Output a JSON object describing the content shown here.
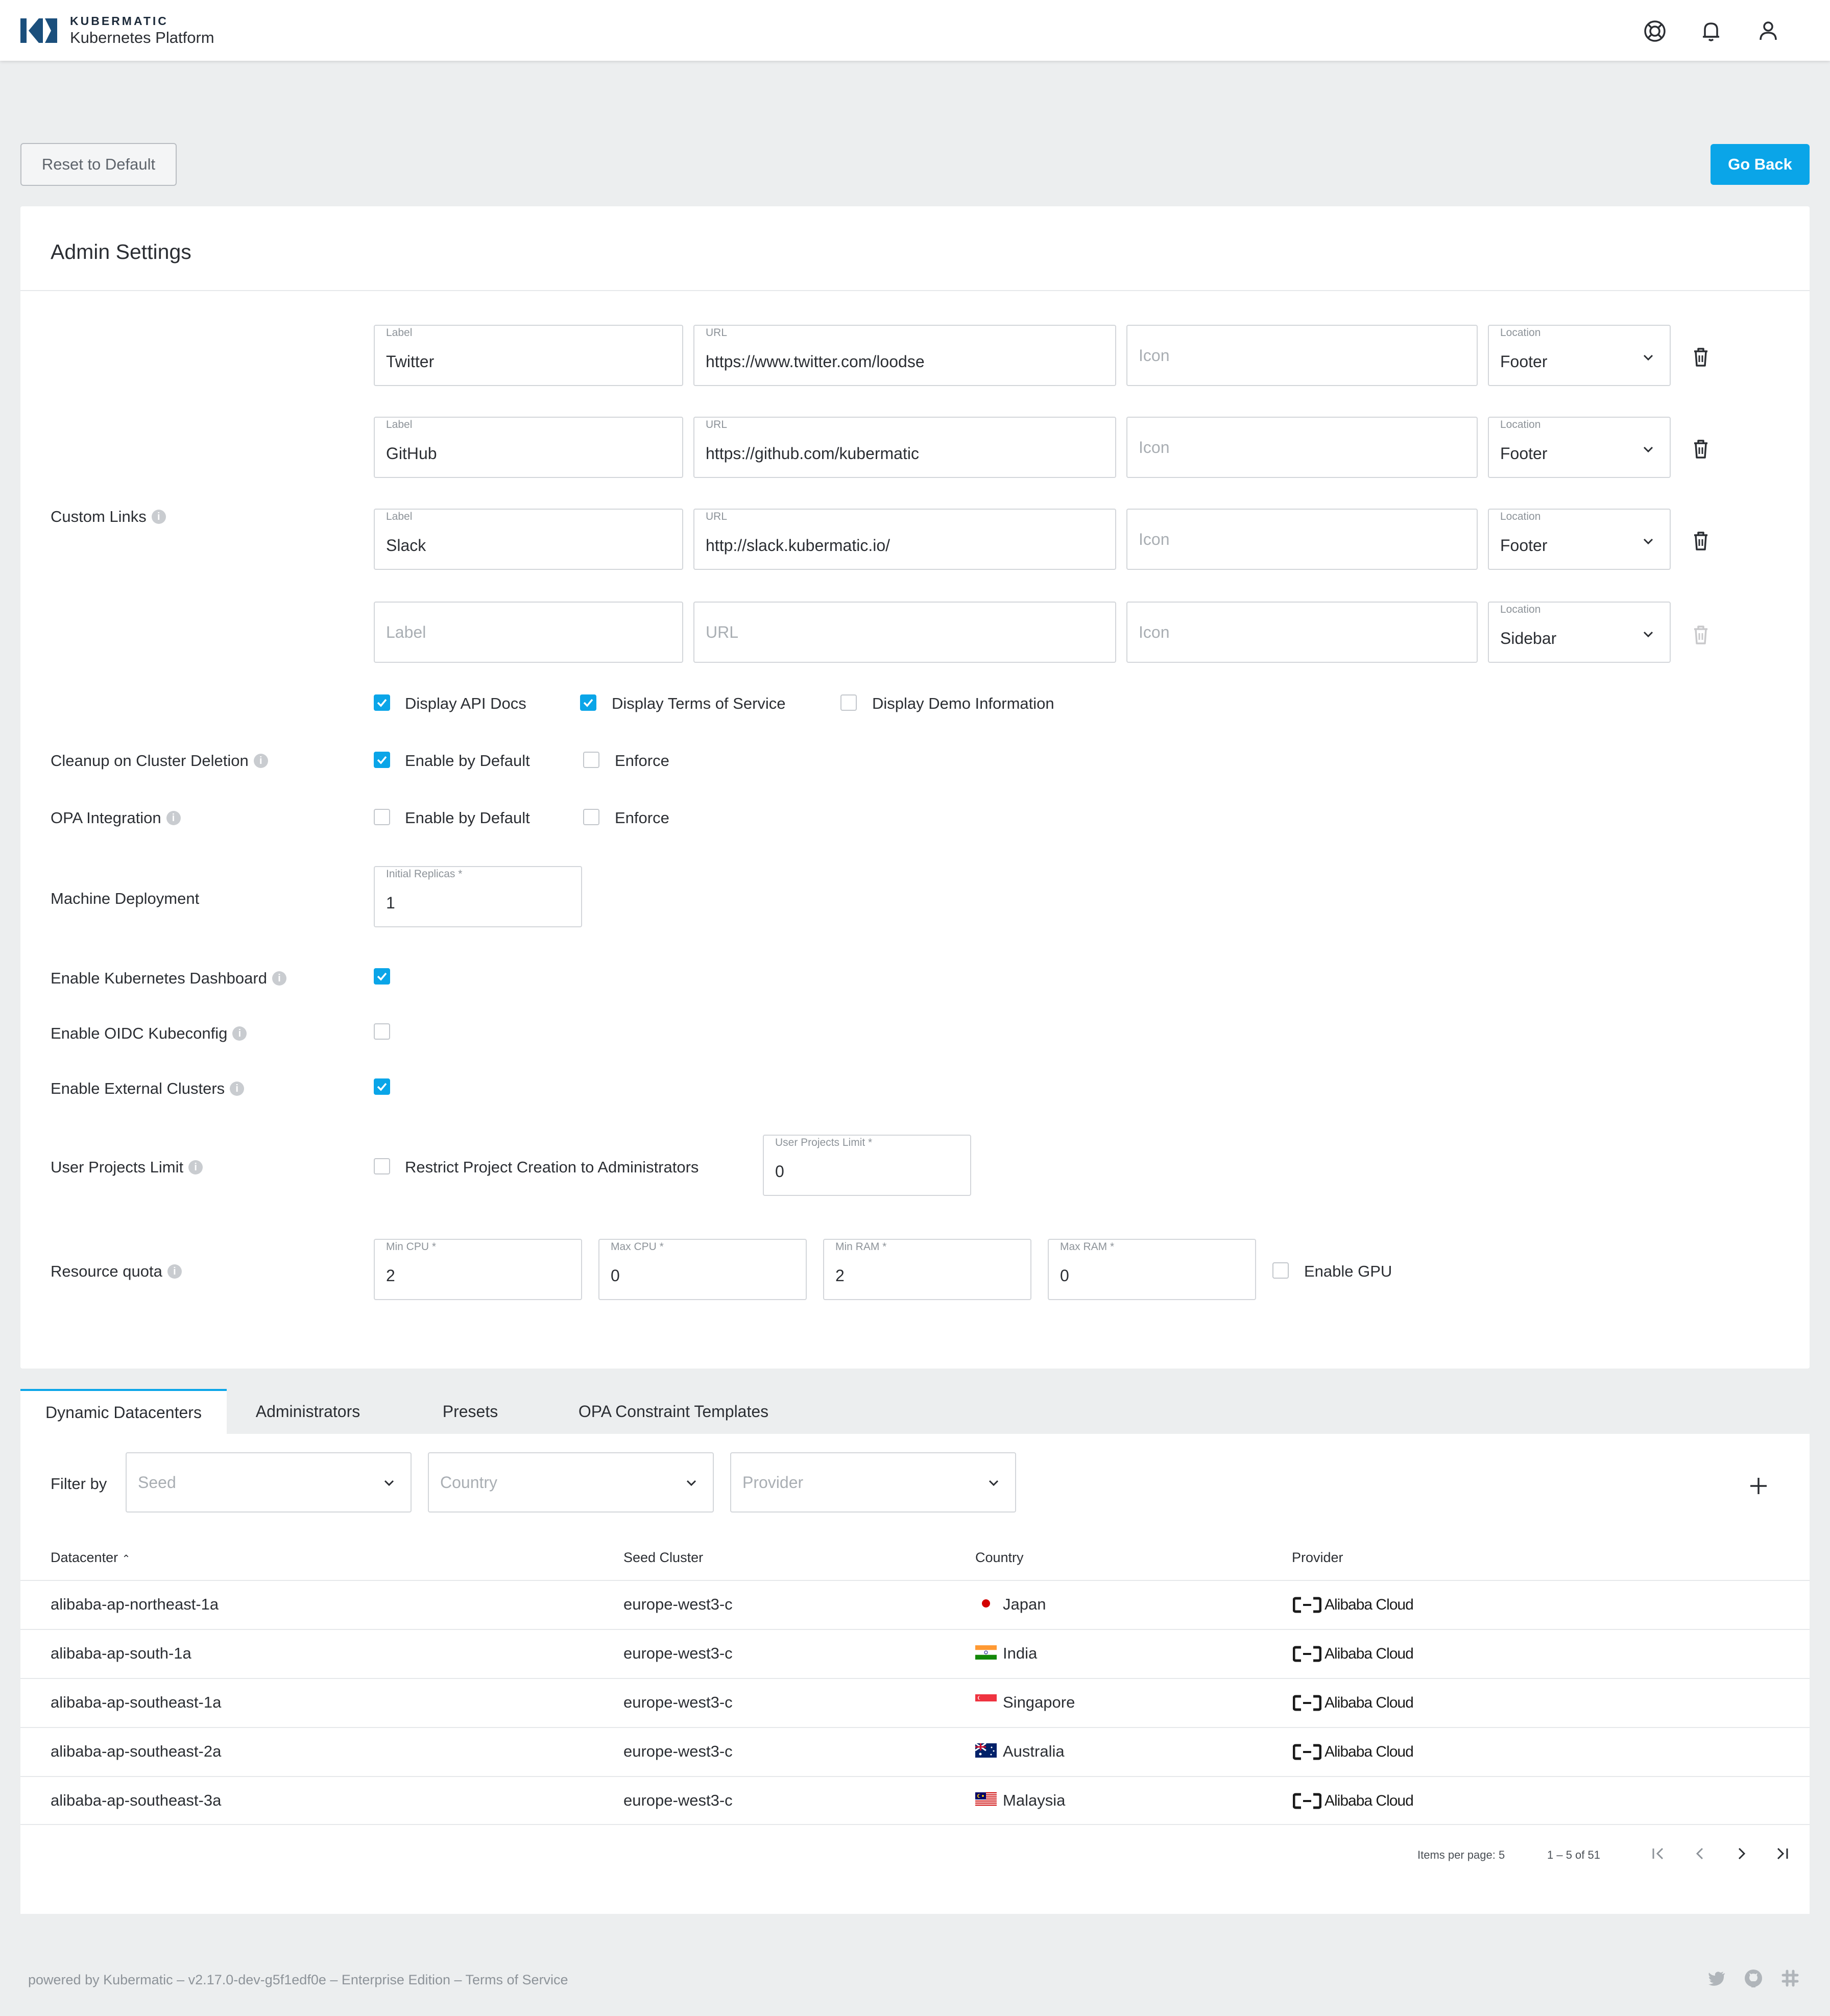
{
  "header": {
    "brand": "KUBERMATIC",
    "subtitle": "Kubernetes Platform",
    "icons": [
      "help-icon",
      "bell-icon",
      "user-icon"
    ]
  },
  "actions": {
    "reset": "Reset to Default",
    "go_back": "Go Back"
  },
  "admin": {
    "title": "Admin Settings",
    "custom_links": {
      "label": "Custom Links",
      "field_labels": {
        "label": "Label",
        "url": "URL",
        "icon": "Icon",
        "location": "Location"
      },
      "rows": [
        {
          "label": "Twitter",
          "url": "https://www.twitter.com/loodse",
          "icon": "",
          "location": "Footer"
        },
        {
          "label": "GitHub",
          "url": "https://github.com/kubermatic",
          "icon": "",
          "location": "Footer"
        },
        {
          "label": "Slack",
          "url": "http://slack.kubermatic.io/",
          "icon": "",
          "location": "Footer"
        },
        {
          "label": "",
          "url": "",
          "icon": "",
          "location": "Sidebar"
        }
      ],
      "display_options": [
        {
          "label": "Display API Docs",
          "checked": true
        },
        {
          "label": "Display Terms of Service",
          "checked": true
        },
        {
          "label": "Display Demo Information",
          "checked": false
        }
      ]
    },
    "cleanup": {
      "label": "Cleanup on Cluster Deletion",
      "enable_by_default": "Enable by Default",
      "enforce": "Enforce"
    },
    "opa": {
      "label": "OPA Integration",
      "enable_by_default": "Enable by Default",
      "enforce": "Enforce"
    },
    "machine_deployment": {
      "label": "Machine Deployment",
      "field_label": "Initial Replicas *",
      "value": "1"
    },
    "k8s_dashboard": {
      "label": "Enable Kubernetes Dashboard",
      "checked": true
    },
    "oidc": {
      "label": "Enable OIDC Kubeconfig",
      "checked": false
    },
    "external_clusters": {
      "label": "Enable External Clusters",
      "checked": true
    },
    "user_projects": {
      "label": "User Projects Limit",
      "restrict": "Restrict Project Creation to Administrators",
      "field_label": "User Projects Limit *",
      "value": "0"
    },
    "resource_quota": {
      "label": "Resource quota",
      "min_cpu_label": "Min CPU *",
      "min_cpu": "2",
      "max_cpu_label": "Max CPU *",
      "max_cpu": "0",
      "min_ram_label": "Min RAM *",
      "min_ram": "2",
      "max_ram_label": "Max RAM *",
      "max_ram": "0",
      "gpu": "Enable GPU"
    }
  },
  "tabs": [
    "Dynamic Datacenters",
    "Administrators",
    "Presets",
    "OPA Constraint Templates"
  ],
  "filters": {
    "label": "Filter by",
    "seed": "Seed",
    "country": "Country",
    "provider": "Provider"
  },
  "table": {
    "columns": [
      "Datacenter",
      "Seed Cluster",
      "Country",
      "Provider"
    ],
    "rows": [
      {
        "datacenter": "alibaba-ap-northeast-1a",
        "seed": "europe-west3-c",
        "country": "Japan",
        "provider": "Alibaba Cloud"
      },
      {
        "datacenter": "alibaba-ap-south-1a",
        "seed": "europe-west3-c",
        "country": "India",
        "provider": "Alibaba Cloud"
      },
      {
        "datacenter": "alibaba-ap-southeast-1a",
        "seed": "europe-west3-c",
        "country": "Singapore",
        "provider": "Alibaba Cloud"
      },
      {
        "datacenter": "alibaba-ap-southeast-2a",
        "seed": "europe-west3-c",
        "country": "Australia",
        "provider": "Alibaba Cloud"
      },
      {
        "datacenter": "alibaba-ap-southeast-3a",
        "seed": "europe-west3-c",
        "country": "Malaysia",
        "provider": "Alibaba Cloud"
      }
    ]
  },
  "pagination": {
    "items_per_page": "Items per page: 5",
    "range": "1 – 5 of 51"
  },
  "footer": {
    "text": "powered by Kubermatic –  v2.17.0-dev-g5f1edf0e –  Enterprise Edition –  Terms of Service"
  },
  "colors": {
    "accent": "#0aa5e8",
    "background": "#eceeef"
  }
}
